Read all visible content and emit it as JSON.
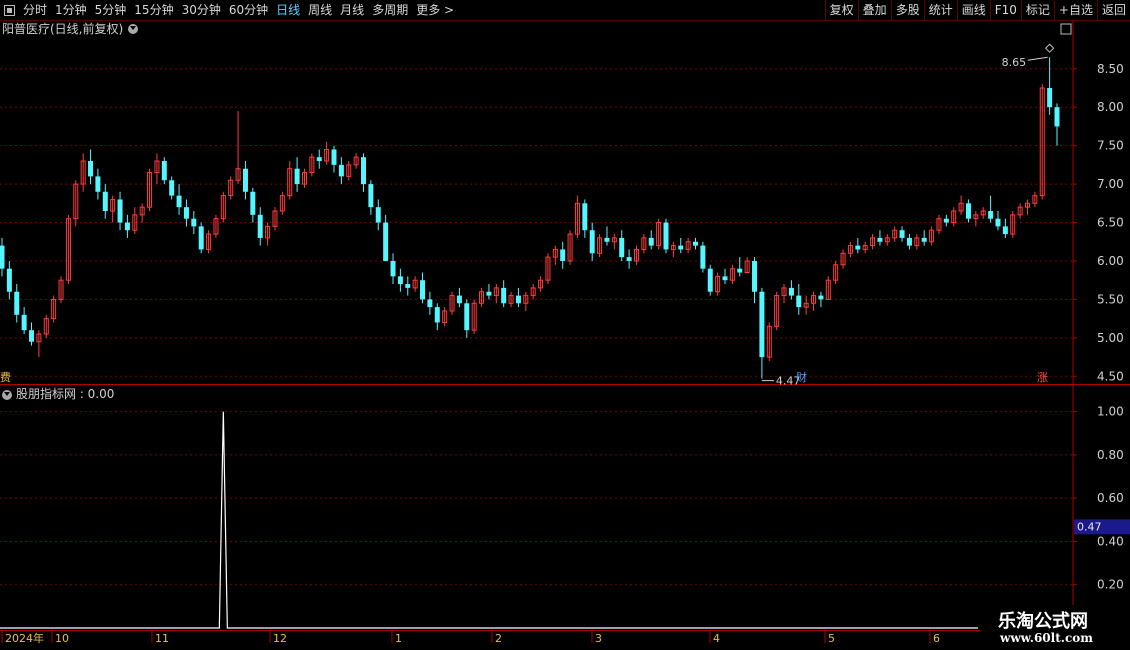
{
  "toolbar": {
    "left": [
      "分时",
      "1分钟",
      "5分钟",
      "15分钟",
      "30分钟",
      "60分钟",
      "日线",
      "周线",
      "月线",
      "多周期",
      "更多 >"
    ],
    "active_index": 6,
    "right": [
      "复权",
      "叠加",
      "多股",
      "统计",
      "画线",
      "F10",
      "标记",
      "+自选",
      "返回"
    ]
  },
  "chart_title": "阳普医疗(日线,前复权)",
  "indicator_title": "股朋指标网 : 0.00",
  "price_axis_ticks": [
    "8.50",
    "8.00",
    "7.50",
    "7.00",
    "6.50",
    "6.00",
    "5.50",
    "5.00",
    "4.50"
  ],
  "indicator_axis_ticks": [
    "1.00",
    "0.80",
    "0.60",
    "0.40",
    "0.20"
  ],
  "indicator_value_badge": "0.47",
  "high_label": "8.65",
  "low_label": "4.47",
  "date_axis": [
    "2024年",
    "10",
    "11",
    "12",
    "1",
    "2",
    "3",
    "4",
    "5",
    "6"
  ],
  "tags": {
    "left": "费",
    "cai": "财",
    "zhang": "涨"
  },
  "watermark": {
    "line1": "乐淘公式网",
    "line2": "www.60lt.com"
  },
  "colors": {
    "up": "#ff3c3c",
    "down": "#54f6ff",
    "grid": "#7a0000",
    "axis": "#b00000"
  },
  "chart_data": {
    "type": "candlestick",
    "title": "阳普医疗(日线,前复权)",
    "ylim": [
      4.4,
      8.9
    ],
    "ohlc": [
      [
        6.2,
        6.3,
        5.8,
        5.9
      ],
      [
        5.9,
        6.0,
        5.5,
        5.6
      ],
      [
        5.6,
        5.7,
        5.2,
        5.3
      ],
      [
        5.3,
        5.4,
        5.05,
        5.1
      ],
      [
        5.1,
        5.2,
        4.9,
        4.95
      ],
      [
        4.95,
        5.1,
        4.75,
        5.05
      ],
      [
        5.05,
        5.3,
        5.0,
        5.25
      ],
      [
        5.25,
        5.55,
        5.2,
        5.5
      ],
      [
        5.5,
        5.8,
        5.45,
        5.75
      ],
      [
        5.75,
        6.6,
        5.7,
        6.55
      ],
      [
        6.55,
        7.05,
        6.45,
        7.0
      ],
      [
        7.0,
        7.4,
        6.9,
        7.3
      ],
      [
        7.3,
        7.45,
        7.0,
        7.1
      ],
      [
        7.1,
        7.2,
        6.8,
        6.9
      ],
      [
        6.9,
        7.0,
        6.55,
        6.65
      ],
      [
        6.65,
        6.85,
        6.5,
        6.8
      ],
      [
        6.8,
        6.9,
        6.4,
        6.5
      ],
      [
        6.5,
        6.6,
        6.3,
        6.4
      ],
      [
        6.4,
        6.7,
        6.35,
        6.6
      ],
      [
        6.6,
        6.75,
        6.5,
        6.7
      ],
      [
        6.7,
        7.2,
        6.65,
        7.15
      ],
      [
        7.15,
        7.4,
        7.0,
        7.3
      ],
      [
        7.3,
        7.35,
        7.0,
        7.05
      ],
      [
        7.05,
        7.1,
        6.8,
        6.85
      ],
      [
        6.85,
        7.0,
        6.6,
        6.7
      ],
      [
        6.7,
        6.8,
        6.45,
        6.55
      ],
      [
        6.55,
        6.65,
        6.35,
        6.45
      ],
      [
        6.45,
        6.5,
        6.1,
        6.15
      ],
      [
        6.15,
        6.4,
        6.1,
        6.35
      ],
      [
        6.35,
        6.6,
        6.3,
        6.55
      ],
      [
        6.55,
        6.9,
        6.5,
        6.85
      ],
      [
        6.85,
        7.1,
        6.8,
        7.05
      ],
      [
        7.05,
        7.95,
        7.0,
        7.2
      ],
      [
        7.2,
        7.3,
        6.8,
        6.9
      ],
      [
        6.9,
        6.95,
        6.5,
        6.6
      ],
      [
        6.6,
        6.7,
        6.2,
        6.3
      ],
      [
        6.3,
        6.5,
        6.2,
        6.45
      ],
      [
        6.45,
        6.7,
        6.4,
        6.65
      ],
      [
        6.65,
        6.9,
        6.6,
        6.85
      ],
      [
        6.85,
        7.3,
        6.8,
        7.2
      ],
      [
        7.2,
        7.35,
        6.9,
        7.0
      ],
      [
        7.0,
        7.2,
        6.95,
        7.15
      ],
      [
        7.15,
        7.4,
        7.1,
        7.35
      ],
      [
        7.35,
        7.45,
        7.2,
        7.3
      ],
      [
        7.3,
        7.55,
        7.25,
        7.45
      ],
      [
        7.45,
        7.5,
        7.15,
        7.25
      ],
      [
        7.25,
        7.35,
        7.0,
        7.1
      ],
      [
        7.1,
        7.3,
        7.05,
        7.25
      ],
      [
        7.25,
        7.4,
        7.2,
        7.35
      ],
      [
        7.35,
        7.4,
        6.9,
        7.0
      ],
      [
        7.0,
        7.05,
        6.6,
        6.7
      ],
      [
        6.7,
        6.8,
        6.4,
        6.5
      ],
      [
        6.5,
        6.6,
        6.0,
        6.0
      ],
      [
        6.0,
        6.1,
        5.7,
        5.8
      ],
      [
        5.8,
        5.9,
        5.6,
        5.7
      ],
      [
        5.7,
        5.8,
        5.55,
        5.65
      ],
      [
        5.65,
        5.8,
        5.6,
        5.75
      ],
      [
        5.75,
        5.85,
        5.45,
        5.5
      ],
      [
        5.5,
        5.6,
        5.3,
        5.4
      ],
      [
        5.4,
        5.45,
        5.1,
        5.2
      ],
      [
        5.2,
        5.4,
        5.15,
        5.35
      ],
      [
        5.35,
        5.6,
        5.3,
        5.55
      ],
      [
        5.55,
        5.65,
        5.4,
        5.45
      ],
      [
        5.45,
        5.5,
        5.0,
        5.1
      ],
      [
        5.1,
        5.5,
        5.05,
        5.45
      ],
      [
        5.45,
        5.65,
        5.4,
        5.6
      ],
      [
        5.6,
        5.7,
        5.5,
        5.55
      ],
      [
        5.55,
        5.7,
        5.45,
        5.65
      ],
      [
        5.65,
        5.75,
        5.4,
        5.45
      ],
      [
        5.45,
        5.6,
        5.4,
        5.55
      ],
      [
        5.55,
        5.65,
        5.4,
        5.45
      ],
      [
        5.45,
        5.6,
        5.35,
        5.55
      ],
      [
        5.55,
        5.7,
        5.5,
        5.65
      ],
      [
        5.65,
        5.8,
        5.6,
        5.75
      ],
      [
        5.75,
        6.1,
        5.7,
        6.05
      ],
      [
        6.05,
        6.2,
        5.95,
        6.15
      ],
      [
        6.15,
        6.25,
        5.9,
        6.0
      ],
      [
        6.0,
        6.4,
        5.95,
        6.35
      ],
      [
        6.35,
        6.85,
        6.3,
        6.75
      ],
      [
        6.75,
        6.8,
        6.3,
        6.4
      ],
      [
        6.4,
        6.5,
        6.0,
        6.1
      ],
      [
        6.1,
        6.35,
        6.05,
        6.3
      ],
      [
        6.3,
        6.45,
        6.2,
        6.25
      ],
      [
        6.25,
        6.35,
        6.15,
        6.3
      ],
      [
        6.3,
        6.4,
        6.0,
        6.05
      ],
      [
        6.05,
        6.15,
        5.9,
        6.0
      ],
      [
        6.0,
        6.2,
        5.95,
        6.15
      ],
      [
        6.15,
        6.35,
        6.1,
        6.3
      ],
      [
        6.3,
        6.4,
        6.15,
        6.2
      ],
      [
        6.2,
        6.55,
        6.15,
        6.5
      ],
      [
        6.5,
        6.55,
        6.1,
        6.15
      ],
      [
        6.15,
        6.25,
        6.05,
        6.2
      ],
      [
        6.2,
        6.3,
        6.1,
        6.15
      ],
      [
        6.15,
        6.3,
        6.1,
        6.25
      ],
      [
        6.25,
        6.3,
        6.15,
        6.2
      ],
      [
        6.2,
        6.25,
        5.85,
        5.9
      ],
      [
        5.9,
        5.95,
        5.55,
        5.6
      ],
      [
        5.6,
        5.85,
        5.55,
        5.8
      ],
      [
        5.8,
        5.9,
        5.7,
        5.75
      ],
      [
        5.75,
        5.95,
        5.7,
        5.9
      ],
      [
        5.9,
        6.05,
        5.8,
        5.85
      ],
      [
        5.85,
        6.05,
        5.85,
        6.0
      ],
      [
        6.0,
        6.05,
        5.45,
        5.6
      ],
      [
        5.6,
        5.65,
        4.47,
        4.75
      ],
      [
        4.75,
        5.2,
        4.7,
        5.15
      ],
      [
        5.15,
        5.6,
        5.1,
        5.55
      ],
      [
        5.55,
        5.7,
        5.45,
        5.65
      ],
      [
        5.65,
        5.75,
        5.5,
        5.55
      ],
      [
        5.55,
        5.7,
        5.3,
        5.4
      ],
      [
        5.4,
        5.55,
        5.3,
        5.45
      ],
      [
        5.45,
        5.6,
        5.35,
        5.55
      ],
      [
        5.55,
        5.6,
        5.4,
        5.5
      ],
      [
        5.5,
        5.8,
        5.5,
        5.75
      ],
      [
        5.75,
        6.0,
        5.7,
        5.95
      ],
      [
        5.95,
        6.15,
        5.9,
        6.1
      ],
      [
        6.1,
        6.25,
        6.05,
        6.2
      ],
      [
        6.2,
        6.3,
        6.1,
        6.15
      ],
      [
        6.15,
        6.25,
        6.1,
        6.2
      ],
      [
        6.2,
        6.35,
        6.15,
        6.3
      ],
      [
        6.3,
        6.4,
        6.2,
        6.25
      ],
      [
        6.25,
        6.35,
        6.2,
        6.3
      ],
      [
        6.3,
        6.45,
        6.25,
        6.4
      ],
      [
        6.4,
        6.45,
        6.25,
        6.3
      ],
      [
        6.3,
        6.35,
        6.15,
        6.2
      ],
      [
        6.2,
        6.35,
        6.15,
        6.3
      ],
      [
        6.3,
        6.4,
        6.2,
        6.25
      ],
      [
        6.25,
        6.45,
        6.2,
        6.4
      ],
      [
        6.4,
        6.6,
        6.35,
        6.55
      ],
      [
        6.55,
        6.6,
        6.45,
        6.5
      ],
      [
        6.5,
        6.7,
        6.45,
        6.65
      ],
      [
        6.65,
        6.85,
        6.6,
        6.75
      ],
      [
        6.75,
        6.8,
        6.5,
        6.55
      ],
      [
        6.55,
        6.65,
        6.45,
        6.6
      ],
      [
        6.6,
        6.7,
        6.55,
        6.65
      ],
      [
        6.65,
        6.85,
        6.5,
        6.55
      ],
      [
        6.55,
        6.65,
        6.4,
        6.45
      ],
      [
        6.45,
        6.55,
        6.3,
        6.35
      ],
      [
        6.35,
        6.65,
        6.3,
        6.6
      ],
      [
        6.6,
        6.75,
        6.55,
        6.7
      ],
      [
        6.7,
        6.8,
        6.6,
        6.75
      ],
      [
        6.75,
        6.9,
        6.7,
        6.85
      ],
      [
        6.85,
        8.3,
        6.8,
        8.25
      ],
      [
        8.25,
        8.65,
        7.9,
        8.0
      ],
      [
        8.0,
        8.05,
        7.5,
        7.75
      ]
    ],
    "indicator": {
      "spike_index": 30,
      "spike_value": 1.0,
      "ylim": [
        0.0,
        1.1
      ]
    }
  }
}
